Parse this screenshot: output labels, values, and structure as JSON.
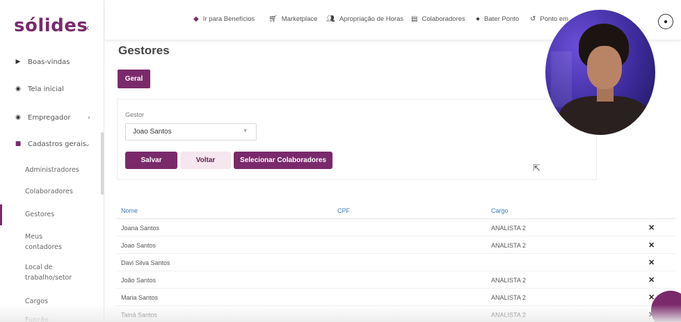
{
  "brand": {
    "name": "sólides",
    "color": "#7a2a6b"
  },
  "sidebar": {
    "collapse_icon": "‹",
    "items": [
      {
        "label": "Boas-vindas",
        "icon": "play-icon",
        "glyph": "▶"
      },
      {
        "label": "Tela inicial",
        "icon": "dashboard-icon",
        "glyph": "◉"
      },
      {
        "label": "Empregador",
        "icon": "building-icon",
        "glyph": "◉",
        "arrow": "›"
      },
      {
        "label": "Cadastros gerais",
        "icon": "form-icon",
        "glyph": "■",
        "arrow": "⌄"
      }
    ],
    "sub_items": [
      {
        "label": "Administradores"
      },
      {
        "label": "Colaboradores"
      },
      {
        "label": "Gestores",
        "active": true
      },
      {
        "label": "Meus contadores"
      },
      {
        "label": "Local de trabalho/setor"
      },
      {
        "label": "Cargos"
      },
      {
        "label": "Função"
      }
    ]
  },
  "topbar": {
    "links": [
      {
        "label": "Ir para Benefícios",
        "icon": "benefits-icon"
      },
      {
        "label": "Marketplace",
        "icon": "cart-icon"
      },
      {
        "label": "Apropriação de Horas",
        "icon": "users-icon"
      },
      {
        "label": "Colaboradores",
        "icon": "document-icon"
      },
      {
        "label": "Bater Ponto",
        "icon": "clock-icon"
      },
      {
        "label": "Ponto em",
        "icon": "history-icon"
      }
    ],
    "user_icon": "user-icon"
  },
  "main": {
    "title": "Gestores",
    "tab": "Geral",
    "form": {
      "gestor_label": "Gestor",
      "gestor_value": "Joao Santos"
    },
    "buttons": {
      "save": "Salvar",
      "back": "Voltar",
      "select": "Selecionar Colaboradores"
    },
    "table": {
      "headers": {
        "nome": "Nome",
        "cpf": "CPF",
        "cargo": "Cargo"
      },
      "rows": [
        {
          "nome": "Joana Santos",
          "cpf": "",
          "cargo": "ANALISTA 2"
        },
        {
          "nome": "Joao Santos",
          "cpf": "",
          "cargo": "ANALISTA 2"
        },
        {
          "nome": "Davi Silva Santos",
          "cpf": "",
          "cargo": ""
        },
        {
          "nome": "João Santos",
          "cpf": "",
          "cargo": "ANALISTA 2"
        },
        {
          "nome": "Maria Santos",
          "cpf": "",
          "cargo": "ANALISTA 2"
        },
        {
          "nome": "Tainá Santos",
          "cpf": "",
          "cargo": "ANALISTA 2"
        }
      ]
    }
  },
  "colors": {
    "accent": "#7a2a6b",
    "accent_light": "#f5e6ef",
    "header_link": "#3a7bbf"
  }
}
